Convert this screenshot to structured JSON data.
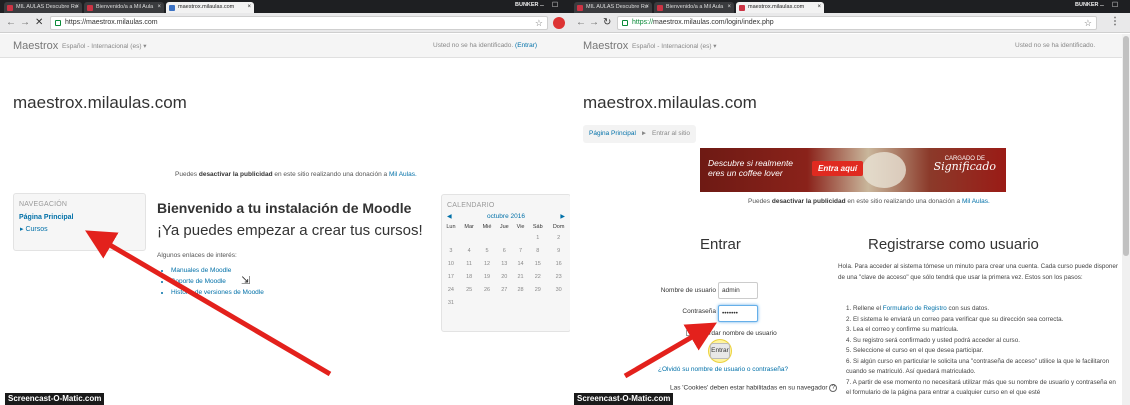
{
  "left": {
    "tabs": [
      {
        "label": "MIL AULAS Descubre Ro"
      },
      {
        "label": "Bienvenido/a a Mil Aula"
      },
      {
        "label": "maestrox.milaulas.com"
      }
    ],
    "window_user": "BUNKER",
    "url": "https://maestrox.milaulas.com",
    "brand": "Maestrox",
    "lang": "Español - Internacional (es) ▾",
    "login_prefix": "Usted no se ha identificado.",
    "login_link": "(Entrar)",
    "site_title": "maestrox.milaulas.com",
    "ad_note": {
      "pre": "Puedes",
      "bold": "desactivar la publicidad",
      "mid": "en este sitio realizando una donación a",
      "link": "Mil Aulas."
    },
    "nav": {
      "title": "NAVEGACIÓN",
      "home": "Página Principal",
      "courses": "Cursos"
    },
    "welcome": "Bienvenido a tu instalación de Moodle",
    "start": "¡Ya puedes empezar a crear tus cursos!",
    "links_head": "Algunos enlaces de interés:",
    "links": [
      "Manuales de Moodle",
      "Soporte de Moodle",
      "Historia de versiones de Moodle"
    ],
    "calendar": {
      "title": "CALENDARIO",
      "month": "octubre 2016",
      "days": [
        "Lun",
        "Mar",
        "Mié",
        "Jue",
        "Vie",
        "Sáb",
        "Dom"
      ],
      "rows": [
        [
          "",
          "",
          "",
          "",
          "",
          "1",
          "2"
        ],
        [
          "3",
          "4",
          "5",
          "6",
          "7",
          "8",
          "9"
        ],
        [
          "10",
          "11",
          "12",
          "13",
          "14",
          "15",
          "16"
        ],
        [
          "17",
          "18",
          "19",
          "20",
          "21",
          "22",
          "23"
        ],
        [
          "24",
          "25",
          "26",
          "27",
          "28",
          "29",
          "30"
        ],
        [
          "31",
          "",
          "",
          "",
          "",
          "",
          ""
        ]
      ]
    },
    "watermark": "Screencast-O-Matic.com"
  },
  "right": {
    "tabs": [
      {
        "label": "MIL AULAS Descubre Ro"
      },
      {
        "label": "Bienvenido/a a Mil Aula"
      },
      {
        "label": "maestrox.milaulas.com"
      }
    ],
    "window_user": "BUNKER",
    "url_secure": "https://",
    "url_rest": "maestrox.milaulas.com/login/index.php",
    "brand": "Maestrox",
    "lang": "Español - Internacional (es) ▾",
    "login_info": "Usted no se ha identificado.",
    "site_title": "maestrox.milaulas.com",
    "breadcrumb": {
      "home": "Página Principal",
      "sep": "►",
      "current": "Entrar al sitio"
    },
    "ad": {
      "line1": "Descubre si realmente",
      "line2": "eres un coffee lover",
      "cta": "Entra aquí",
      "brand_small": "CARGADO DE",
      "brand_big": "Significado"
    },
    "ad_note": {
      "pre": "Puedes",
      "bold": "desactivar la publicidad",
      "mid": "en este sitio realizando una donación a",
      "link": "Mil Aulas."
    },
    "login": {
      "heading": "Entrar",
      "username_label": "Nombre de usuario",
      "username_value": "admin",
      "password_label": "Contraseña",
      "password_value": "•••••••",
      "remember": "Recordar nombre de usuario",
      "submit": "Entrar",
      "forgot": "¿Olvidó su nombre de usuario o contraseña?",
      "cookies": "Las 'Cookies' deben estar habilitadas en su navegador"
    },
    "register": {
      "heading": "Registrarse como usuario",
      "intro": "Hola. Para acceder al sistema tómese un minuto para crear una cuenta. Cada curso puede disponer de una \"clave de acceso\" que sólo tendrá que usar la primera vez. Estos son los pasos:",
      "steps": [
        "1. Rellene el Formulario de Registro con sus datos.",
        "2. El sistema le enviará un correo para verificar que su dirección sea correcta.",
        "3. Lea el correo y confirme su matrícula.",
        "4. Su registro será confirmado y usted podrá acceder al curso.",
        "5. Seleccione el curso en el que desea participar.",
        "6. Si algún curso en particular le solicita una \"contraseña de acceso\" utilice la que le facilitaron cuando se matriculó. Así quedará matriculado.",
        "7. A partir de ese momento no necesitará utilizar más que su nombre de usuario y contraseña en el formulario de la página para entrar a cualquier curso en el que esté"
      ],
      "form_link": "Formulario de Registro"
    },
    "watermark": "Screencast-O-Matic.com"
  },
  "colors": {
    "link": "#0070a8",
    "arrow": "#e3211c",
    "chrome_dark": "#1e1f22"
  }
}
